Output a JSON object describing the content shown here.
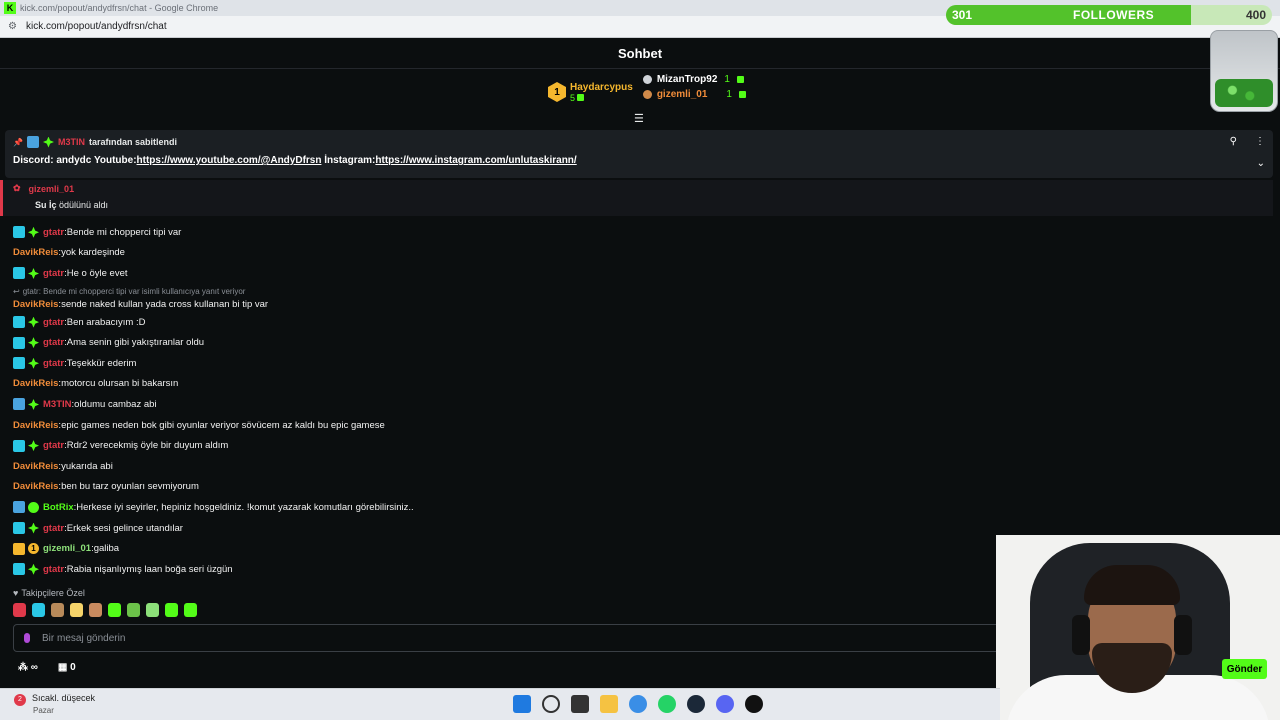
{
  "browser": {
    "window_title": "kick.com/popout/andydfrsn/chat - Google Chrome",
    "url": "kick.com/popout/andydfrsn/chat"
  },
  "chat": {
    "title": "Sohbet",
    "leaderboard": {
      "first": {
        "rank": "1",
        "name": "Haydarcypus",
        "count": "5"
      },
      "second": {
        "name": "MizanTrop92",
        "count": "1"
      },
      "third": {
        "name": "gizemli_01",
        "count": "1"
      }
    },
    "pinned": {
      "pinned_by": "M3TIN",
      "pinned_by_suffix": "tarafından sabitlendi",
      "text_prefix": "Discord: andydc Youtube:",
      "youtube_link": "https://www.youtube.com/@AndyDfrsn",
      "instagram_prefix": " İnstagram:",
      "instagram_link": "https://www.instagram.com/unlutaskirann/"
    },
    "reward": {
      "user": "gizemli_01",
      "reward_name": "Su İç",
      "reward_suffix": " ödülünü aldı"
    },
    "messages": [
      {
        "user": "gtatr",
        "color": "#e0394a",
        "badges": [
          "sub",
          "verified"
        ],
        "text": "Bende mi chopperci tipi var"
      },
      {
        "user": "DavikReis",
        "color": "#f08c3a",
        "badges": [],
        "text": "yok kardeşinde"
      },
      {
        "user": "gtatr",
        "color": "#e0394a",
        "badges": [
          "sub",
          "verified"
        ],
        "text": "He o öyle evet"
      },
      {
        "reply": "gtatr: Bende mi chopperci tipi var isimli kullanıcıya yanıt veriyor",
        "user": "DavikReis",
        "color": "#f08c3a",
        "badges": [],
        "text": "sende naked kullan yada cross kullanan bi tip var"
      },
      {
        "user": "gtatr",
        "color": "#e0394a",
        "badges": [
          "sub",
          "verified"
        ],
        "text": "Ben arabacıyım :D"
      },
      {
        "user": "gtatr",
        "color": "#e0394a",
        "badges": [
          "sub",
          "verified"
        ],
        "text": "Ama senin gibi yakıştıranlar oldu"
      },
      {
        "user": "gtatr",
        "color": "#e0394a",
        "badges": [
          "sub",
          "verified"
        ],
        "text": "Teşekkür ederim"
      },
      {
        "user": "DavikReis",
        "color": "#f08c3a",
        "badges": [],
        "text": "motorcu olursan bi bakarsın"
      },
      {
        "user": "M3TIN",
        "color": "#e0394a",
        "badges": [
          "mod",
          "verified"
        ],
        "text": "oldumu cambaz abi"
      },
      {
        "user": "DavikReis",
        "color": "#f08c3a",
        "badges": [],
        "text": "epic games neden bok gibi oyunlar veriyor sövücem az kaldı bu epic gamese"
      },
      {
        "user": "gtatr",
        "color": "#e0394a",
        "badges": [
          "sub",
          "verified"
        ],
        "text": "Rdr2 verecekmiş öyle bir duyum aldım"
      },
      {
        "user": "DavikReis",
        "color": "#f08c3a",
        "badges": [],
        "text": "yukarıda abi"
      },
      {
        "user": "DavikReis",
        "color": "#f08c3a",
        "badges": [],
        "text": "ben bu tarz oyunları sevmiyorum"
      },
      {
        "user": "BotRix",
        "color": "#53fc18",
        "badges": [
          "mod",
          "bot"
        ],
        "text": "Herkese iyi seyirler, hepiniz hoşgeldiniz. !komut yazarak komutları görebilirsiniz.."
      },
      {
        "user": "gtatr",
        "color": "#e0394a",
        "badges": [
          "sub",
          "verified"
        ],
        "text": "Erkek sesi gelince utandılar"
      },
      {
        "user": "gizemli_01",
        "color": "#8de07a",
        "badges": [
          "crown",
          "one"
        ],
        "text": "galiba"
      },
      {
        "user": "gtatr",
        "color": "#e0394a",
        "badges": [
          "sub",
          "verified"
        ],
        "text": "Rabia nişanlıymış laan boğa seri üzgün"
      }
    ],
    "followers_only_label": "Takipçilere Özel",
    "emotes": [
      "#e0394a",
      "#2ac7e6",
      "#b88a5a",
      "#f5d36a",
      "#c98a5f",
      "#53fc18",
      "#6cc24a",
      "#8de07a",
      "#53fc18",
      "#53fc18"
    ],
    "input_placeholder": "Bir mesaj gönderin",
    "footer_count": "0",
    "send_label": "Gönder"
  },
  "overlay": {
    "followers_current": "301",
    "followers_label": "FOLLOWERS",
    "followers_goal": "400",
    "progress_fraction": 0.75
  },
  "taskbar": {
    "weather_badge": "2",
    "weather_text": "Sıcakl. düşecek",
    "weather_sub": "Pazar"
  }
}
